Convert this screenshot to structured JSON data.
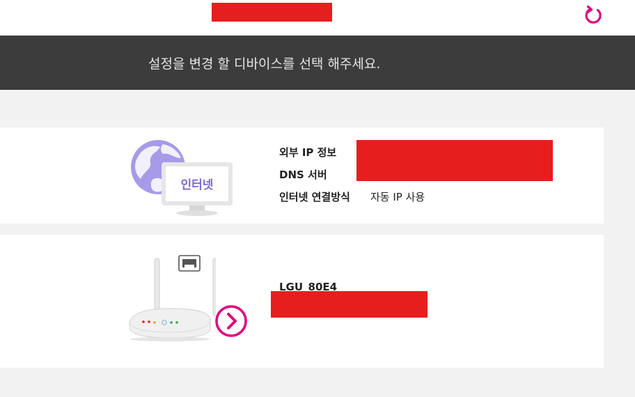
{
  "banner": {
    "message": "설정을 변경 할 디바이스를 선택 해주세요."
  },
  "header": {
    "refresh_icon": "refresh-icon",
    "accent_color": "#e4007f"
  },
  "internet_card": {
    "icon_label": "인터넷",
    "rows": [
      {
        "label": "외부 IP 정보",
        "value": ""
      },
      {
        "label": "DNS 서버",
        "value": ""
      },
      {
        "label": "인터넷 연결방식",
        "value": "자동 IP 사용"
      }
    ]
  },
  "router_card": {
    "device_name": "LGU_80E4",
    "arrow_icon": "chevron-right-circle-icon"
  },
  "colors": {
    "banner_bg": "#3c3c3c",
    "page_bg": "#f2f2f2",
    "redaction": "#e61e1e"
  }
}
